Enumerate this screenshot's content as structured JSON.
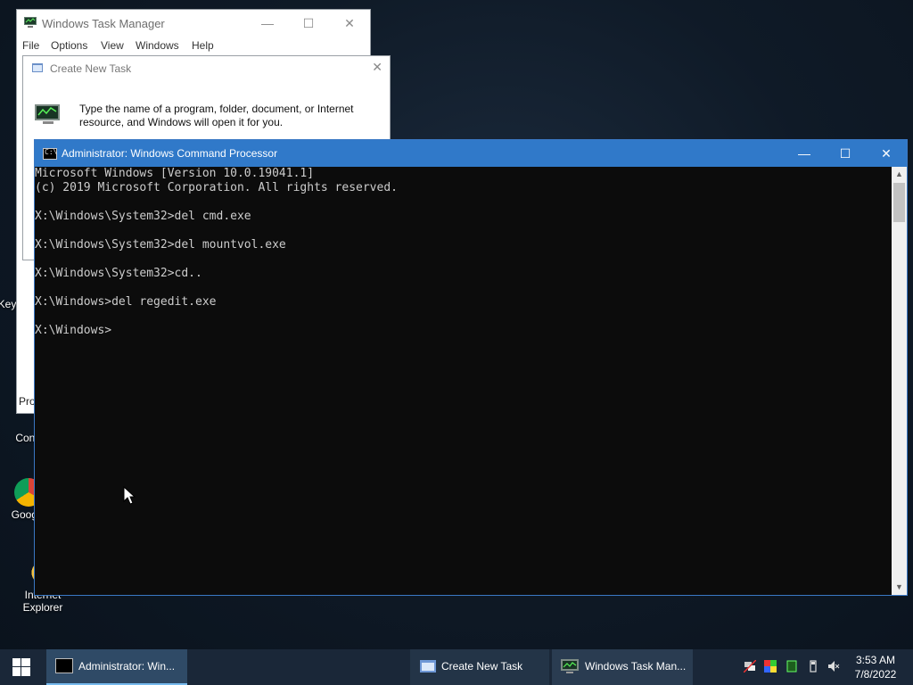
{
  "desktop": {
    "icons": [
      {
        "label": "Key",
        "icon": "keyboard-icon"
      },
      {
        "label": "Contr",
        "icon": "control-panel-icon"
      },
      {
        "label": "Google",
        "icon": "chrome-icon"
      },
      {
        "label": "Internet Explorer",
        "icon": "internet-explorer-icon"
      }
    ]
  },
  "task_manager": {
    "title": "Windows Task Manager",
    "menu": [
      "File",
      "Options",
      "View",
      "Windows",
      "Help"
    ],
    "processes_label": "Pro"
  },
  "run_dialog": {
    "title": "Create New Task",
    "message": "Type the name of a program, folder, document, or Internet resource, and Windows will open it for you."
  },
  "cmd": {
    "title": "Administrator: Windows Command Processor",
    "icon_text": "C:\\",
    "lines": [
      "Microsoft Windows [Version 10.0.19041.1]",
      "(c) 2019 Microsoft Corporation. All rights reserved.",
      "",
      "X:\\Windows\\System32>del cmd.exe",
      "",
      "X:\\Windows\\System32>del mountvol.exe",
      "",
      "X:\\Windows\\System32>cd..",
      "",
      "X:\\Windows>del regedit.exe",
      "",
      "X:\\Windows>"
    ]
  },
  "window_controls": {
    "minimize": "—",
    "maximize": "☐",
    "close": "✕"
  },
  "taskbar": {
    "start_icon": "windows-logo-icon",
    "buttons": [
      {
        "label": "Administrator: Win...",
        "icon": "cmd-icon",
        "active": true
      },
      {
        "label": "Create New Task",
        "icon": "run-icon",
        "active": false
      },
      {
        "label": "Windows Task Man...",
        "icon": "task-manager-icon",
        "active": false
      }
    ],
    "tray_icons": [
      "network-icon",
      "color-icon",
      "battery-icon",
      "usb-icon",
      "volume-muted-icon"
    ],
    "clock": {
      "time": "3:53 AM",
      "date": "7/8/2022"
    }
  },
  "colors": {
    "cmd_titlebar": "#3079c9",
    "cmd_background": "#0c0c0c",
    "cmd_text": "#cccccc",
    "taskbar": "#1a2738"
  }
}
